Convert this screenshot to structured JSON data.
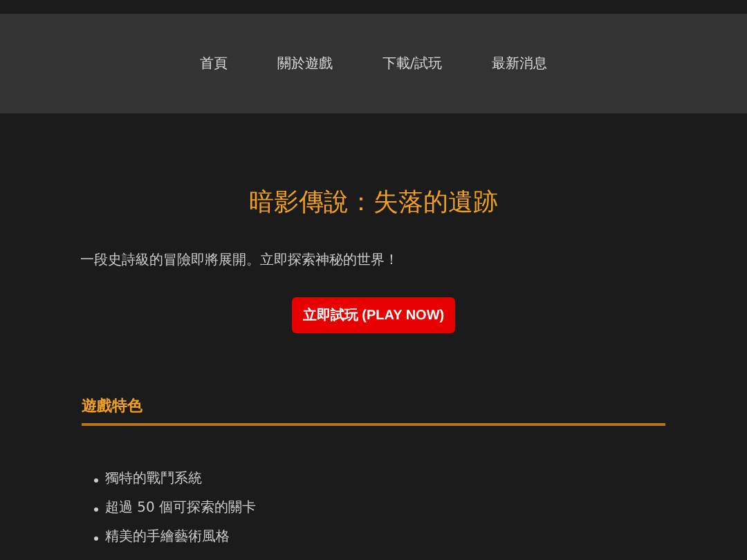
{
  "nav": {
    "items": [
      {
        "label": "首頁"
      },
      {
        "label": "關於遊戲"
      },
      {
        "label": "下載/試玩"
      },
      {
        "label": "最新消息"
      }
    ]
  },
  "hero": {
    "title": "暗影傳說：失落的遺跡",
    "tagline": "一段史詩級的冒險即將展開。立即探索神秘的世界！",
    "button": "立即試玩 (PLAY NOW)"
  },
  "features": {
    "heading": "遊戲特色",
    "items": [
      "獨特的戰鬥系統",
      "超過 50 個可探索的關卡",
      "精美的手繪藝術風格"
    ]
  }
}
